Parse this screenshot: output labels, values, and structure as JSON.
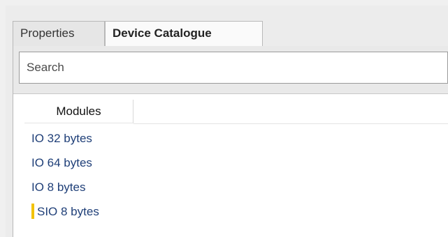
{
  "tabs": [
    {
      "label": "Properties",
      "active": false
    },
    {
      "label": "Device Catalogue",
      "active": true
    }
  ],
  "search": {
    "placeholder": "Search",
    "value": ""
  },
  "list": {
    "column_header": "Modules",
    "items": [
      {
        "label": "IO 32 bytes",
        "marked": false
      },
      {
        "label": "IO 64 bytes",
        "marked": false
      },
      {
        "label": "IO 8 bytes",
        "marked": false
      },
      {
        "label": "SIO 8 bytes",
        "marked": true
      }
    ]
  },
  "colors": {
    "item_text": "#1f3f78",
    "marker": "#f2c200",
    "active_tab_bg": "#fafafa",
    "list_bg": "#ffffff"
  }
}
